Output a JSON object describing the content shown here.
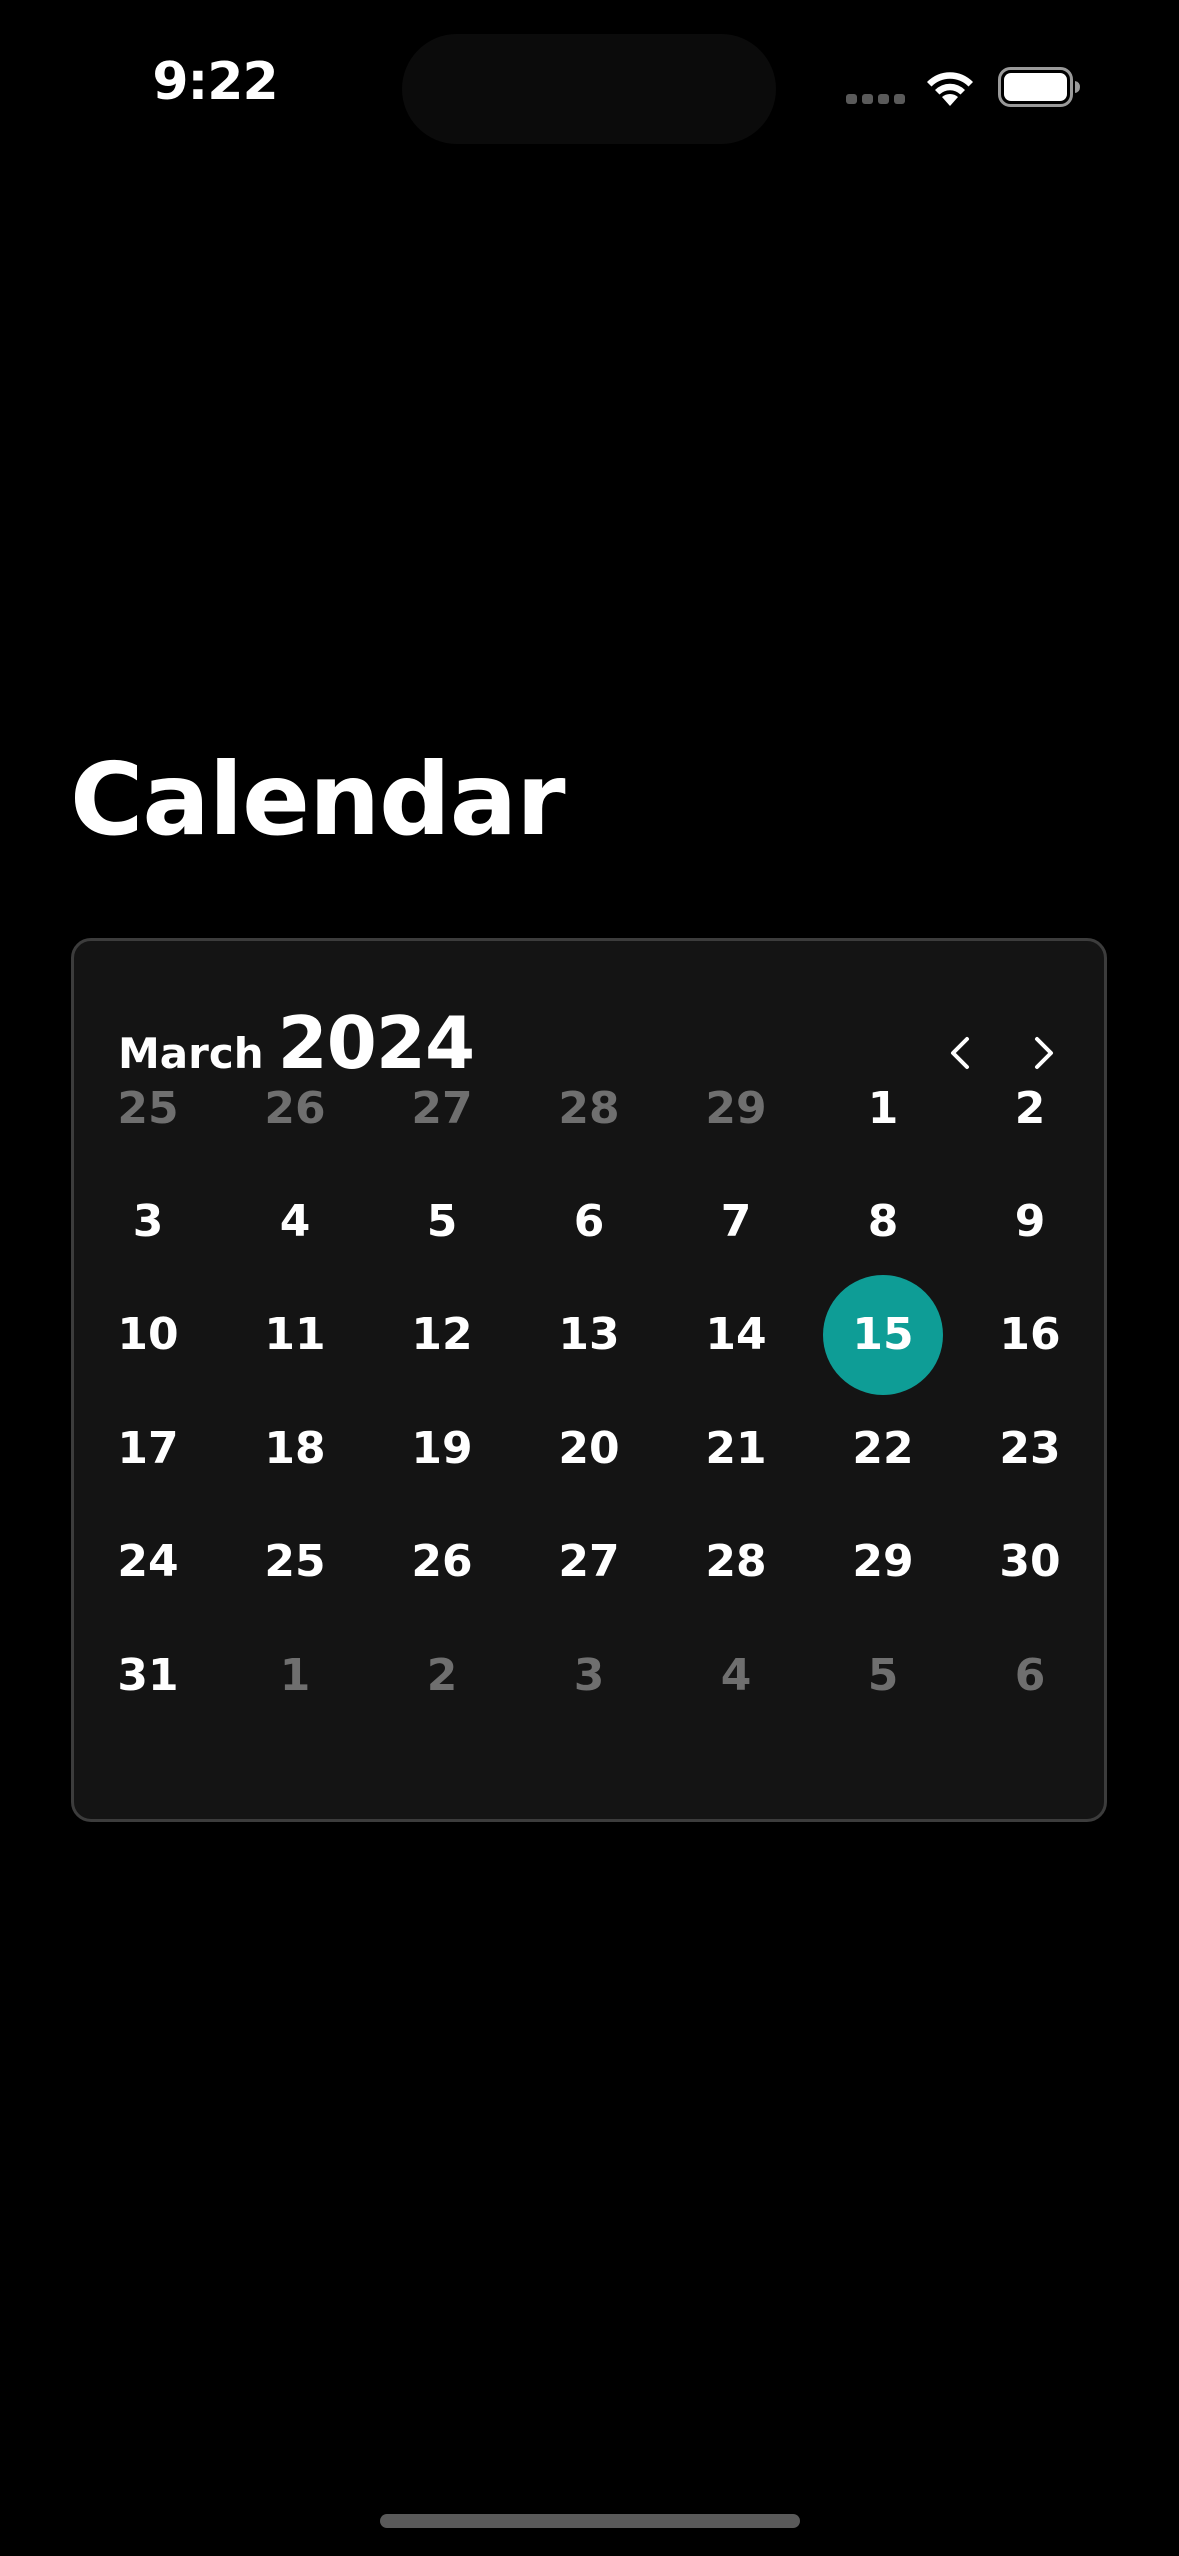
{
  "status_bar": {
    "time": "9:22",
    "icons": [
      "cellular-signal-icon",
      "wifi-icon",
      "battery-icon"
    ]
  },
  "page": {
    "title": "Calendar"
  },
  "calendar": {
    "month": "March",
    "year": "2024",
    "prev_icon": "chevron-left-icon",
    "next_icon": "chevron-right-icon",
    "selected_day": "15",
    "colors": {
      "selected": "#0e9d96",
      "card_background": "#141414",
      "card_border": "#3c3c3c",
      "outside_day": "#6f6f6f"
    },
    "weeks": [
      [
        {
          "d": "25",
          "out": true
        },
        {
          "d": "26",
          "out": true
        },
        {
          "d": "27",
          "out": true
        },
        {
          "d": "28",
          "out": true
        },
        {
          "d": "29",
          "out": true
        },
        {
          "d": "1"
        },
        {
          "d": "2"
        }
      ],
      [
        {
          "d": "3"
        },
        {
          "d": "4"
        },
        {
          "d": "5"
        },
        {
          "d": "6"
        },
        {
          "d": "7"
        },
        {
          "d": "8"
        },
        {
          "d": "9"
        }
      ],
      [
        {
          "d": "10"
        },
        {
          "d": "11"
        },
        {
          "d": "12"
        },
        {
          "d": "13"
        },
        {
          "d": "14"
        },
        {
          "d": "15",
          "sel": true
        },
        {
          "d": "16"
        }
      ],
      [
        {
          "d": "17"
        },
        {
          "d": "18"
        },
        {
          "d": "19"
        },
        {
          "d": "20"
        },
        {
          "d": "21"
        },
        {
          "d": "22"
        },
        {
          "d": "23"
        }
      ],
      [
        {
          "d": "24"
        },
        {
          "d": "25"
        },
        {
          "d": "26"
        },
        {
          "d": "27"
        },
        {
          "d": "28"
        },
        {
          "d": "29"
        },
        {
          "d": "30"
        }
      ],
      [
        {
          "d": "31"
        },
        {
          "d": "1",
          "out": true
        },
        {
          "d": "2",
          "out": true
        },
        {
          "d": "3",
          "out": true
        },
        {
          "d": "4",
          "out": true
        },
        {
          "d": "5",
          "out": true
        },
        {
          "d": "6",
          "out": true
        }
      ]
    ]
  }
}
